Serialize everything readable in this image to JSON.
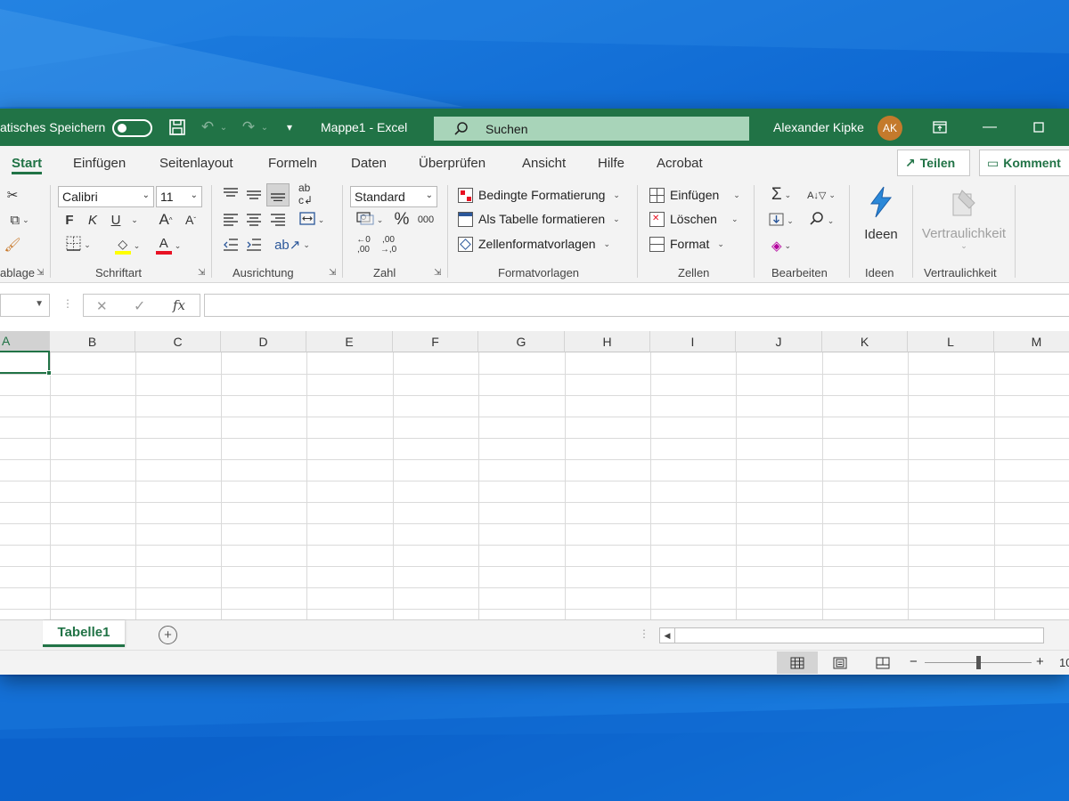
{
  "titlebar": {
    "autosave_label": "atisches Speichern",
    "doc_title": "Mappe1  -  Excel",
    "search_label": "Suchen",
    "user_name": "Alexander Kipke",
    "user_initials": "AK"
  },
  "tabs": [
    "Start",
    "Einfügen",
    "Seitenlayout",
    "Formeln",
    "Daten",
    "Überprüfen",
    "Ansicht",
    "Hilfe",
    "Acrobat"
  ],
  "share": {
    "label": "Teilen",
    "comments_label": "Komment"
  },
  "ribbon": {
    "clipboard": {
      "label": "ablage"
    },
    "font": {
      "name": "Calibri",
      "size": "11",
      "bold": "F",
      "italic": "K",
      "underline": "U",
      "grow": "A",
      "shrink": "A",
      "label": "Schriftart",
      "font_color": "A",
      "highlight_color": "#ffff00",
      "text_color": "#e81123"
    },
    "alignment": {
      "label": "Ausrichtung"
    },
    "number": {
      "format": "Standard",
      "percent": "%",
      "thousands": "000",
      "inc_decimal": "←0 ,00",
      "dec_decimal": ",00 →,0",
      "label": "Zahl"
    },
    "styles": {
      "conditional": "Bedingte Formatierung",
      "as_table": "Als Tabelle formatieren",
      "cell_styles": "Zellenformatvorlagen",
      "label": "Formatvorlagen"
    },
    "cells": {
      "insert": "Einfügen",
      "delete": "Löschen",
      "format": "Format",
      "label": "Zellen"
    },
    "editing": {
      "label": "Bearbeiten"
    },
    "ideas": {
      "button": "Ideen",
      "label": "Ideen"
    },
    "sensitivity": {
      "button": "Vertraulichkeit",
      "label": "Vertraulichkeit"
    }
  },
  "formula": {
    "fx": "fx",
    "cancel": "✕",
    "confirm": "✓"
  },
  "columns": [
    "A",
    "B",
    "C",
    "D",
    "E",
    "F",
    "G",
    "H",
    "I",
    "J",
    "K",
    "L",
    "M"
  ],
  "sheets": [
    {
      "name": "Tabelle1",
      "active": true
    }
  ],
  "status": {
    "zoom_label": "10"
  }
}
